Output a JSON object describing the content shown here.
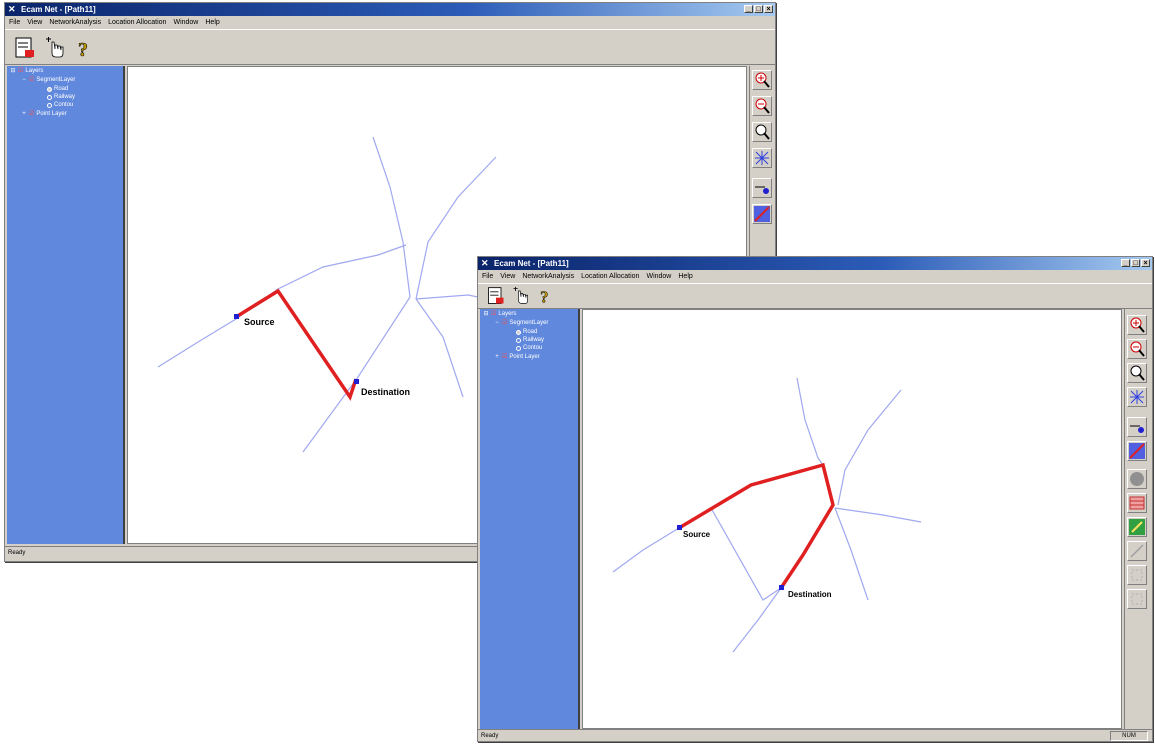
{
  "window_back": {
    "title": "Ecam Net - [Path11]",
    "menu": [
      "File",
      "View",
      "NetworkAnalysis",
      "Location Allocation",
      "Window",
      "Help"
    ],
    "tree": {
      "root": "Layers",
      "segment_layer": "SegmentLayer",
      "items": [
        "Road",
        "Railway",
        "Contou"
      ],
      "point_layer": "Point Layer"
    },
    "labels": {
      "source": "Source",
      "destination": "Destination"
    },
    "status": "Ready"
  },
  "window_front": {
    "title": "Ecam Net - [Path11]",
    "menu": [
      "File",
      "View",
      "NetworkAnalysis",
      "Location Allocation",
      "Window",
      "Help"
    ],
    "tree": {
      "root": "Layers",
      "segment_layer": "SegmentLayer",
      "items": [
        "Road",
        "Railway",
        "Contou"
      ],
      "point_layer": "Point Layer"
    },
    "labels": {
      "source": "Source",
      "destination": "Destination"
    },
    "status": "Ready",
    "status_right": "NUM"
  },
  "icons": {
    "toolbar": [
      "layer-edit-icon",
      "pointer-hand-icon",
      "help-question-icon"
    ],
    "right_tools": [
      "zoom-in-icon",
      "zoom-out-icon",
      "zoom-window-icon",
      "full-extent-icon",
      "add-node-icon",
      "draw-segment-icon",
      "circle-icon",
      "table-icon",
      "pencil-icon",
      "line-icon",
      "disabled-tool-icon",
      "disabled-tool-icon"
    ]
  },
  "colors": {
    "title_bar": "#0a246a",
    "tree_background": "#6088dc",
    "road": "#a0a8f0",
    "path": "#e02020",
    "node": "#2020d0"
  }
}
